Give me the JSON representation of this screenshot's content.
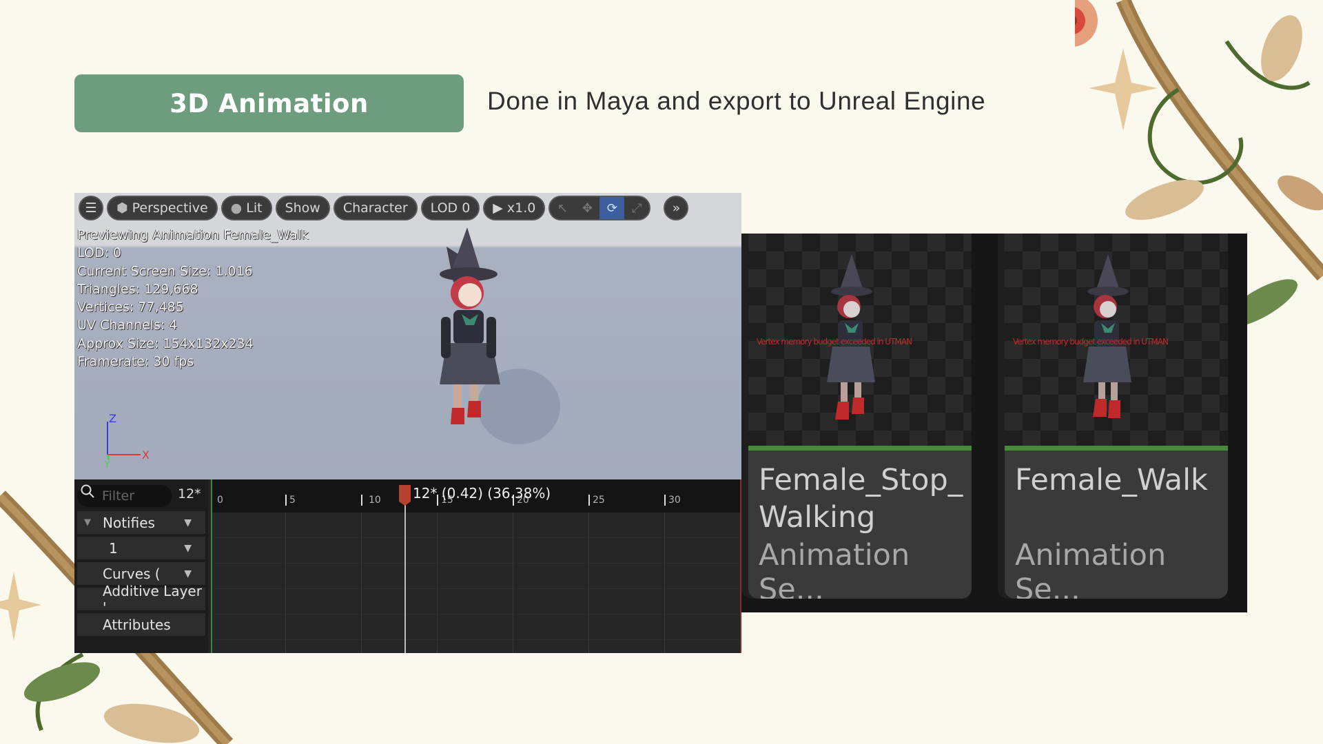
{
  "header": {
    "title": "3D Animation",
    "subtitle": "Done in Maya and export to Unreal Engine"
  },
  "viewport": {
    "toolbar": {
      "perspective": "Perspective",
      "lit": "Lit",
      "show": "Show",
      "character": "Character",
      "lod": "LOD 0",
      "speed": "x1.0"
    },
    "stats": {
      "preview": "Previewing Animation Female_Walk",
      "lod": "LOD: 0",
      "screen_size": "Current Screen Size: 1.016",
      "triangles": "Triangles: 129,668",
      "vertices": "Vertices: 77,485",
      "uv_channels": "UV Channels: 4",
      "approx_size": "Approx Size: 154x132x234",
      "framerate": "Framerate: 30 fps"
    },
    "axis": {
      "z": "Z",
      "x": "X",
      "y": "Y"
    }
  },
  "timeline": {
    "filter_placeholder": "Filter",
    "frame_count": "12*",
    "tracks": [
      "Notifies",
      "1",
      "Curves  (",
      "Additive Layer '",
      "Attributes"
    ],
    "ticks": [
      "0",
      "5",
      "10",
      "15",
      "20",
      "25",
      "30"
    ],
    "playhead": "12* (0.42) (36.38%)"
  },
  "assets": [
    {
      "name": "Female_Stop_ Walking",
      "type": "Animation Se..."
    },
    {
      "name": "Female_Walk",
      "type": "Animation Se..."
    }
  ],
  "thumb_overlay_text": "Vertex memory budget exceeded in UTMAN",
  "colors": {
    "background": "#fbf8ee",
    "title_pill": "#6e9c7e",
    "asset_bar": "#4a8a3a",
    "playhead": "#b5412f"
  }
}
